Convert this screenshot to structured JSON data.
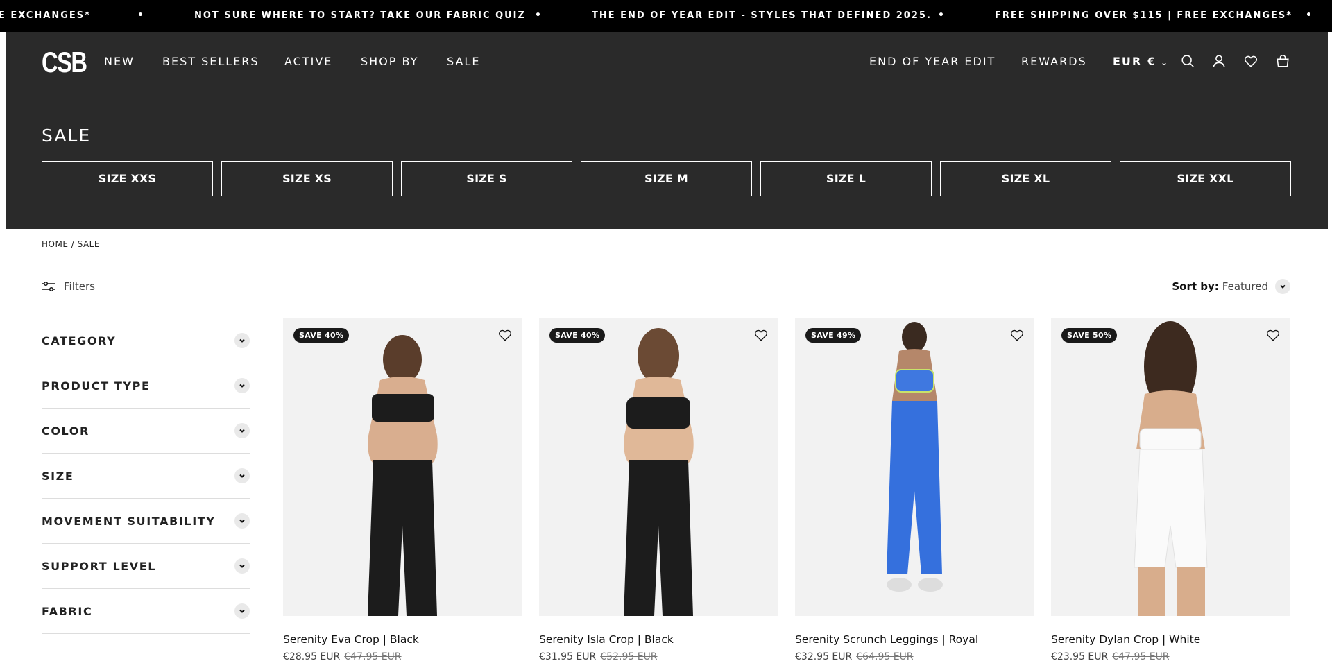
{
  "announcement": {
    "messages": [
      "E EXCHANGES*",
      "NOT SURE WHERE TO START? TAKE OUR FABRIC QUIZ",
      "THE END OF YEAR EDIT - STYLES THAT DEFINED 2025.",
      "FREE SHIPPING OVER $115 | FREE EXCHANGES*"
    ],
    "separator": "•"
  },
  "header": {
    "logo": "CSB",
    "nav_left": [
      "NEW",
      "BEST SELLERS",
      "ACTIVE",
      "SHOP BY",
      "SALE"
    ],
    "nav_right": [
      "END OF YEAR EDIT",
      "REWARDS"
    ],
    "currency": "EUR €",
    "icons": [
      "search-icon",
      "account-icon",
      "wishlist-icon",
      "cart-icon"
    ]
  },
  "collection": {
    "title": "SALE",
    "sizes": [
      "SIZE XXS",
      "SIZE XS",
      "SIZE S",
      "SIZE M",
      "SIZE L",
      "SIZE XL",
      "SIZE XXL"
    ]
  },
  "breadcrumb": {
    "home": "HOME",
    "separator": "/",
    "current": "SALE"
  },
  "toolbar": {
    "filters_label": "Filters",
    "sort_label": "Sort by:",
    "sort_value": "Featured"
  },
  "facets": [
    "CATEGORY",
    "PRODUCT TYPE",
    "COLOR",
    "SIZE",
    "MOVEMENT SUITABILITY",
    "SUPPORT LEVEL",
    "FABRIC"
  ],
  "products": [
    {
      "badge": "SAVE 40%",
      "title": "Serenity Eva Crop | Black",
      "price": "€28.95 EUR",
      "compare_price": "€47.95 EUR",
      "top_color": "#1c1c1c",
      "bottom_color": "#1c1c1c"
    },
    {
      "badge": "SAVE 40%",
      "title": "Serenity Isla Crop | Black",
      "price": "€31.95 EUR",
      "compare_price": "€52.95 EUR",
      "top_color": "#1c1c1c",
      "bottom_color": "#1c1c1c"
    },
    {
      "badge": "SAVE 49%",
      "title": "Serenity Scrunch Leggings | Royal",
      "price": "€32.95 EUR",
      "compare_price": "€64.95 EUR",
      "top_color": "#3f78e0",
      "bottom_color": "#3570dd"
    },
    {
      "badge": "SAVE 50%",
      "title": "Serenity Dylan Crop | White",
      "price": "€23.95 EUR",
      "compare_price": "€47.95 EUR",
      "top_color": "#fafafa",
      "bottom_color": "#fafafa"
    }
  ],
  "colors": {
    "announcement_bg": "#000000",
    "header_bg": "#2a2a2a",
    "card_bg": "#f2f2f2"
  }
}
